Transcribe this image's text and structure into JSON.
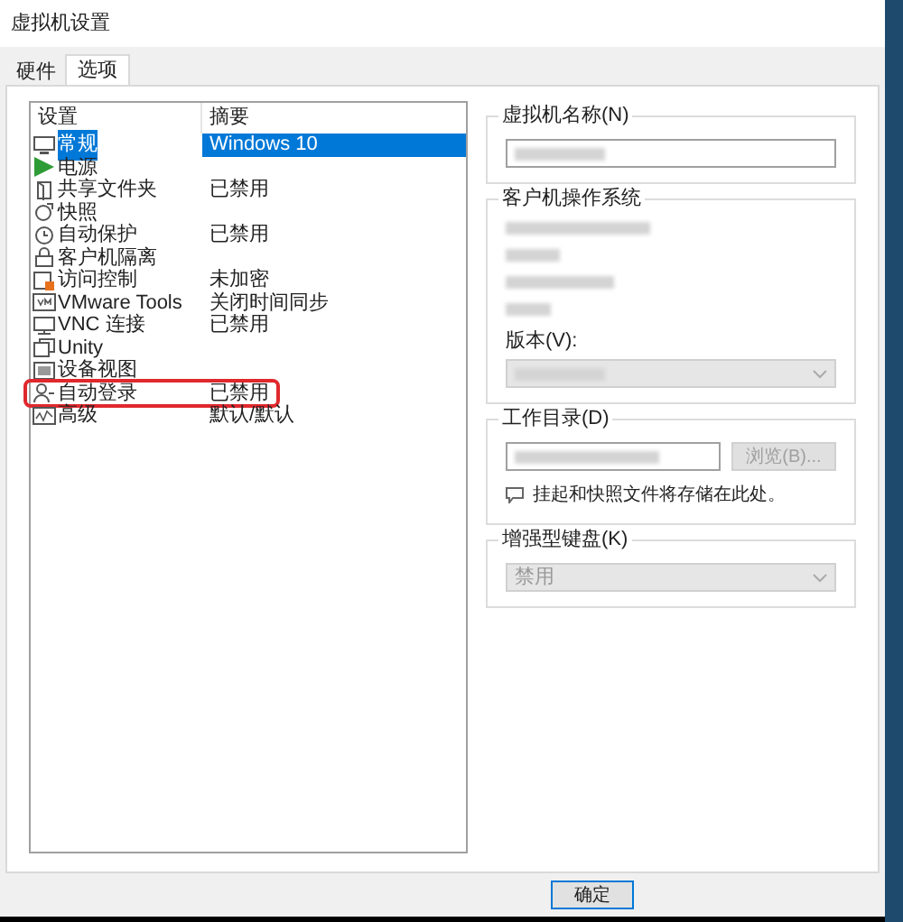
{
  "window": {
    "title": "虚拟机设置"
  },
  "tabs": [
    {
      "label": "硬件",
      "selected": false
    },
    {
      "label": "选项",
      "selected": true
    }
  ],
  "settings_list": {
    "columns": [
      "设置",
      "摘要"
    ],
    "rows": [
      {
        "kind": "monitor",
        "name": "常规",
        "summary": "Windows 10",
        "selected": true,
        "highlighted": false
      },
      {
        "kind": "play",
        "name": "电源",
        "selected": false,
        "highlighted": false
      },
      {
        "kind": "folder",
        "name": "共享文件夹",
        "summary": "已禁用",
        "selected": false,
        "highlighted": false
      },
      {
        "kind": "snapshot",
        "name": "快照",
        "selected": false,
        "highlighted": false
      },
      {
        "kind": "clock",
        "name": "自动保护",
        "summary": "已禁用",
        "selected": false,
        "highlighted": false
      },
      {
        "kind": "lock",
        "name": "客户机隔离",
        "selected": false,
        "highlighted": false
      },
      {
        "kind": "access",
        "name": "访问控制",
        "summary": "未加密",
        "selected": false,
        "highlighted": false
      },
      {
        "kind": "vm",
        "name": "VMware Tools",
        "summary": "关闭时间同步",
        "selected": false,
        "highlighted": false
      },
      {
        "kind": "vnc",
        "name": "VNC 连接",
        "summary": "已禁用",
        "selected": false,
        "highlighted": false
      },
      {
        "kind": "unity",
        "name": "Unity",
        "selected": false,
        "highlighted": false
      },
      {
        "kind": "device",
        "name": "设备视图",
        "selected": false,
        "highlighted": false
      },
      {
        "kind": "user",
        "name": "自动登录",
        "summary": "已禁用",
        "selected": false,
        "highlighted": true
      },
      {
        "kind": "chart",
        "name": "高级",
        "summary": "默认/默认",
        "selected": false,
        "highlighted": false
      }
    ]
  },
  "vm_name": {
    "label": "虚拟机名称(N)"
  },
  "guest_os": {
    "label": "客户机操作系统",
    "version_label": "版本(V):"
  },
  "working_directory": {
    "label": "工作目录(D)",
    "browse_button": "浏览(B)...",
    "browse_disabled": true,
    "note": "挂起和快照文件将存储在此处。"
  },
  "enhanced_keyboard": {
    "label": "增强型键盘(K)",
    "value": "禁用",
    "disabled": true
  },
  "buttons": [
    {
      "label": "确定"
    }
  ]
}
